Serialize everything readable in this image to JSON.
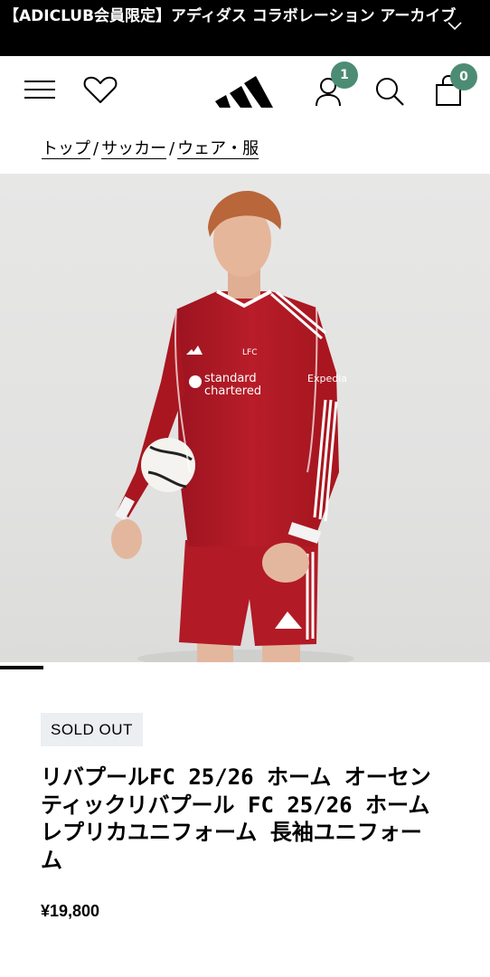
{
  "promo": {
    "text": "【ADICLUB会員限定】アディダス コラボレーション アーカイブ"
  },
  "header": {
    "account_badge_count": "1",
    "cart_badge_count": "0"
  },
  "breadcrumb": {
    "items": [
      "トップ",
      "サッカー",
      "ウェア・服"
    ],
    "separator": "/"
  },
  "product": {
    "status_badge": "SOLD OUT",
    "title": "リバプールFC 25/26 ホーム オーセンティックリバプール FC 25/26 ホーム レプリカユニフォーム 長袖ユニフォーム",
    "price": "¥19,800",
    "jersey_sponsor_line1": "standard",
    "jersey_sponsor_line2": "chartered",
    "sleeve_sponsor": "Expedia",
    "crest_text": "LFC"
  },
  "colors": {
    "badge": "#4d8c74",
    "jersey_red": "#b01b26",
    "banner": "#000000"
  }
}
